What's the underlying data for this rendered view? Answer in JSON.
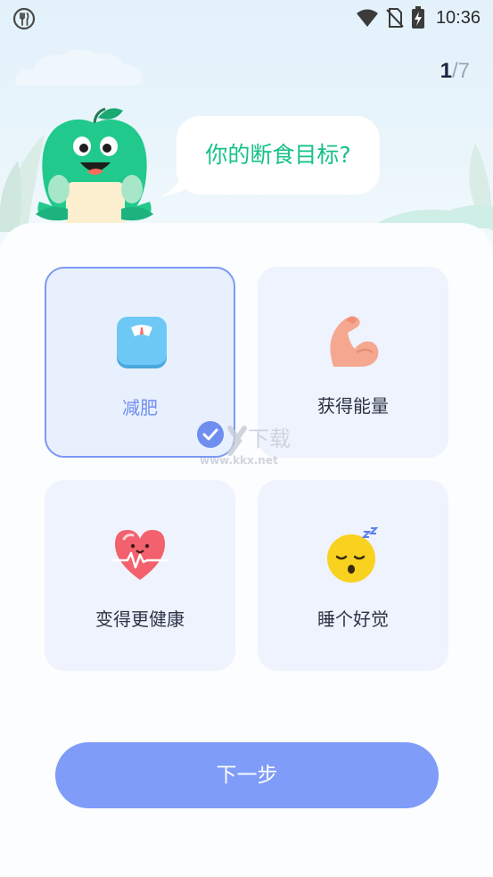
{
  "status_bar": {
    "time": "10:36"
  },
  "progress": {
    "current": "1",
    "separator": "/",
    "total": "7"
  },
  "prompt": {
    "question": "你的断食目标?"
  },
  "options": [
    {
      "label": "减肥",
      "icon": "scale-icon",
      "selected": true
    },
    {
      "label": "获得能量",
      "icon": "flexed-biceps-icon",
      "selected": false
    },
    {
      "label": "变得更健康",
      "icon": "heartbeat-icon",
      "selected": false
    },
    {
      "label": "睡个好觉",
      "icon": "sleeping-face-icon",
      "selected": false
    }
  ],
  "next_button": {
    "label": "下一步"
  },
  "watermark": {
    "line1": "下载",
    "line2": "www.kkx.net"
  },
  "colors": {
    "accent": "#7e9cf8",
    "selected_border": "#7c98f3",
    "prompt_text": "#16c08a",
    "card_bg": "#eef3fd"
  }
}
